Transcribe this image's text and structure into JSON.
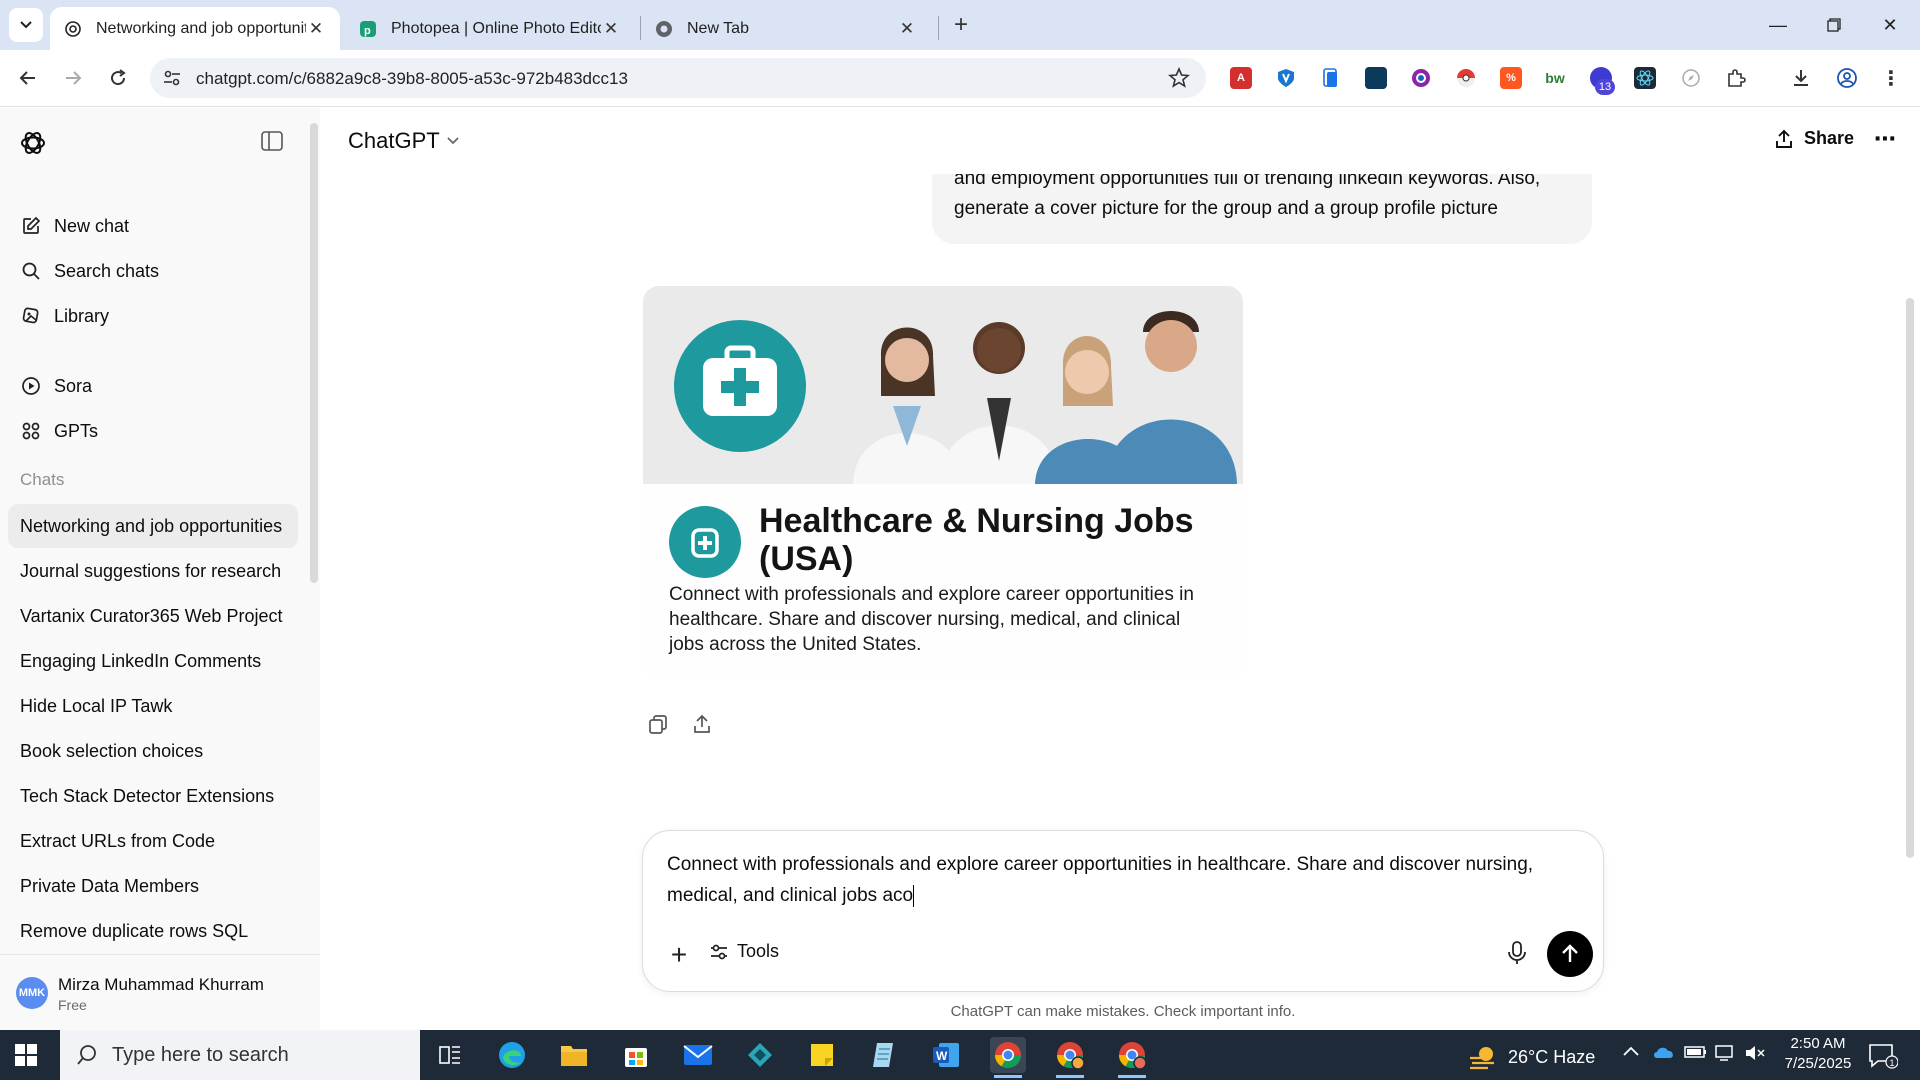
{
  "browser": {
    "tabs": [
      {
        "title": "Networking and job opportunit",
        "active": true
      },
      {
        "title": "Photopea | Online Photo Editor",
        "active": false
      },
      {
        "title": "New Tab",
        "active": false
      }
    ],
    "url": "chatgpt.com/c/6882a9c8-39b8-8005-a53c-972b483dcc13",
    "extension_badge": "13"
  },
  "sidebar": {
    "nav": [
      {
        "label": "New chat",
        "icon": "edit-icon"
      },
      {
        "label": "Search chats",
        "icon": "search-icon"
      },
      {
        "label": "Library",
        "icon": "library-icon"
      },
      {
        "label": "Sora",
        "icon": "play-circle-icon"
      },
      {
        "label": "GPTs",
        "icon": "grid-icon"
      }
    ],
    "section_label": "Chats",
    "chats": [
      "Networking and job opportunities",
      "Journal suggestions for research",
      "Vartanix Curator365 Web Project",
      "Engaging LinkedIn Comments",
      "Hide Local IP Tawk",
      "Book selection choices",
      "Tech Stack Detector Extensions",
      "Extract URLs from Code",
      "Private Data Members",
      "Remove duplicate rows SQL"
    ],
    "user": {
      "initials": "MMK",
      "name": "Mirza Muhammad Khurram",
      "plan": "Free"
    }
  },
  "header": {
    "model": "ChatGPT",
    "share_label": "Share",
    "more_label": "⋯"
  },
  "conversation": {
    "user_message": "and employment opportunities full of trending linkedin keywords. Also, generate a cover picture for the group and a group profile picture",
    "card": {
      "title": "Healthcare & Nursing Jobs (USA)",
      "description": "Connect with professionals and explore career opportunities in healthcare. Share and discover nursing, medical, and clinical jobs across the United States."
    }
  },
  "composer": {
    "text": "Connect with professionals and explore career opportunities in healthcare. Share and discover nursing, medical, and clinical jobs aco",
    "tools_label": "Tools",
    "disclaimer": "ChatGPT can make mistakes. Check important info."
  },
  "taskbar": {
    "search_placeholder": "Type here to search",
    "weather": "26°C  Haze",
    "time": "2:50 AM",
    "date": "7/25/2025",
    "notification_count": "1"
  },
  "colors": {
    "accent_teal": "#1e9a9f",
    "scrub_blue": "#4c8ab8",
    "tab_strip": "#dbe4f4"
  }
}
